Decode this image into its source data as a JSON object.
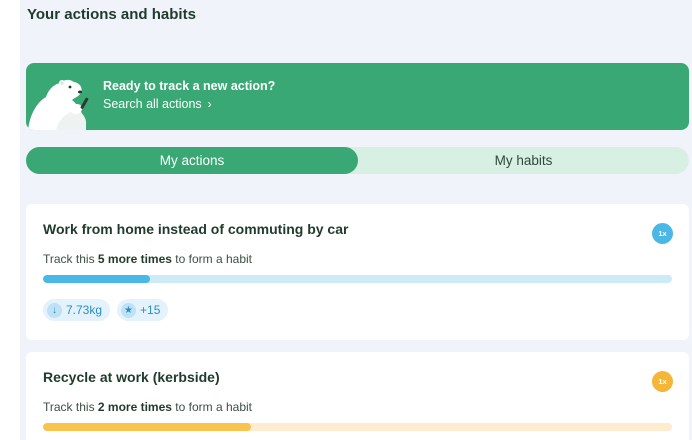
{
  "page_title": "Your actions and habits",
  "banner": {
    "title": "Ready to track a new action?",
    "link_label": "Search all actions",
    "link_chevron": "›"
  },
  "tabs": [
    {
      "label": "My actions",
      "active": true
    },
    {
      "label": "My habits",
      "active": false
    }
  ],
  "cards": [
    {
      "title": "Work from home instead of commuting by car",
      "frequency_badge": "1x",
      "badge_color": "#4ab8e6",
      "track_prefix": "Track this",
      "track_count": "5 more times",
      "track_suffix": "to form a habit",
      "progress": 0.17,
      "progress_color": "#4ab8e6",
      "progress_track_color": "#cdeaf7",
      "chips": [
        {
          "icon": "arrow-down-icon",
          "glyph": "↓",
          "value": "7.73kg"
        },
        {
          "icon": "star-icon",
          "glyph": "★",
          "value": "+15"
        }
      ]
    },
    {
      "title": "Recycle at work (kerbside)",
      "frequency_badge": "1x",
      "badge_color": "#f5b638",
      "track_prefix": "Track this",
      "track_count": "2 more times",
      "track_suffix": "to form a habit",
      "progress": 0.33,
      "progress_color": "#f9c34e",
      "progress_track_color": "#fdeccd"
    }
  ]
}
